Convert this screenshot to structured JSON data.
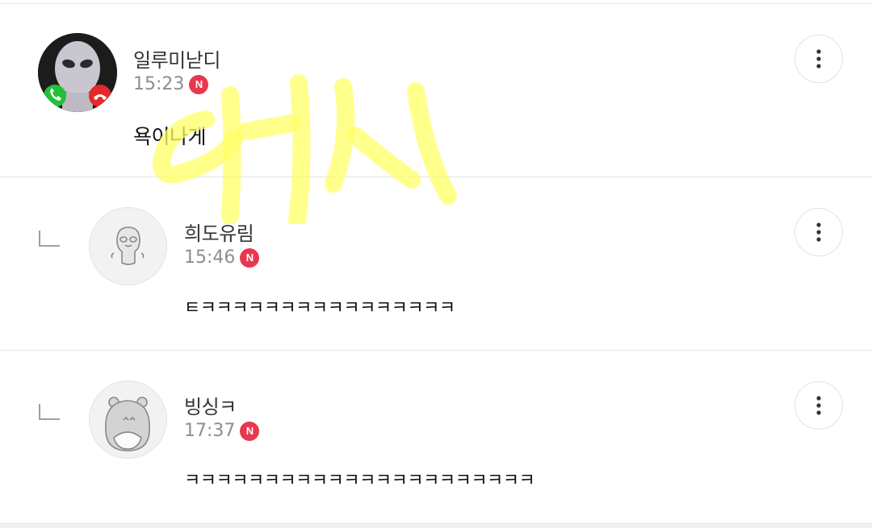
{
  "comments": [
    {
      "author": "일루미낟디",
      "time": "15:23",
      "badge": "N",
      "text": "욕이나게",
      "avatar_icon": "alien-call-avatar",
      "is_reply": false
    },
    {
      "author": "희도유림",
      "time": "15:46",
      "badge": "N",
      "text": "ㅌㅋㅋㅋㅋㅋㅋㅋㅋㅋㅋㅋㅋㅋㅋㅋㅋ",
      "avatar_icon": "character-avatar",
      "is_reply": true
    },
    {
      "author": "빙싱ㅋ",
      "time": "17:37",
      "badge": "N",
      "text": "ㅋㅋㅋㅋㅋㅋㅋㅋㅋㅋㅋㅋㅋㅋㅋㅋㅋㅋㅋㅋㅋㅋ",
      "avatar_icon": "hamster-avatar",
      "is_reply": true
    }
  ],
  "watermark": {
    "text": "여시",
    "color": "#ffff66"
  },
  "colors": {
    "badge": "#e8384f",
    "time": "#8e8e8e",
    "divider": "#e4e4e4"
  }
}
